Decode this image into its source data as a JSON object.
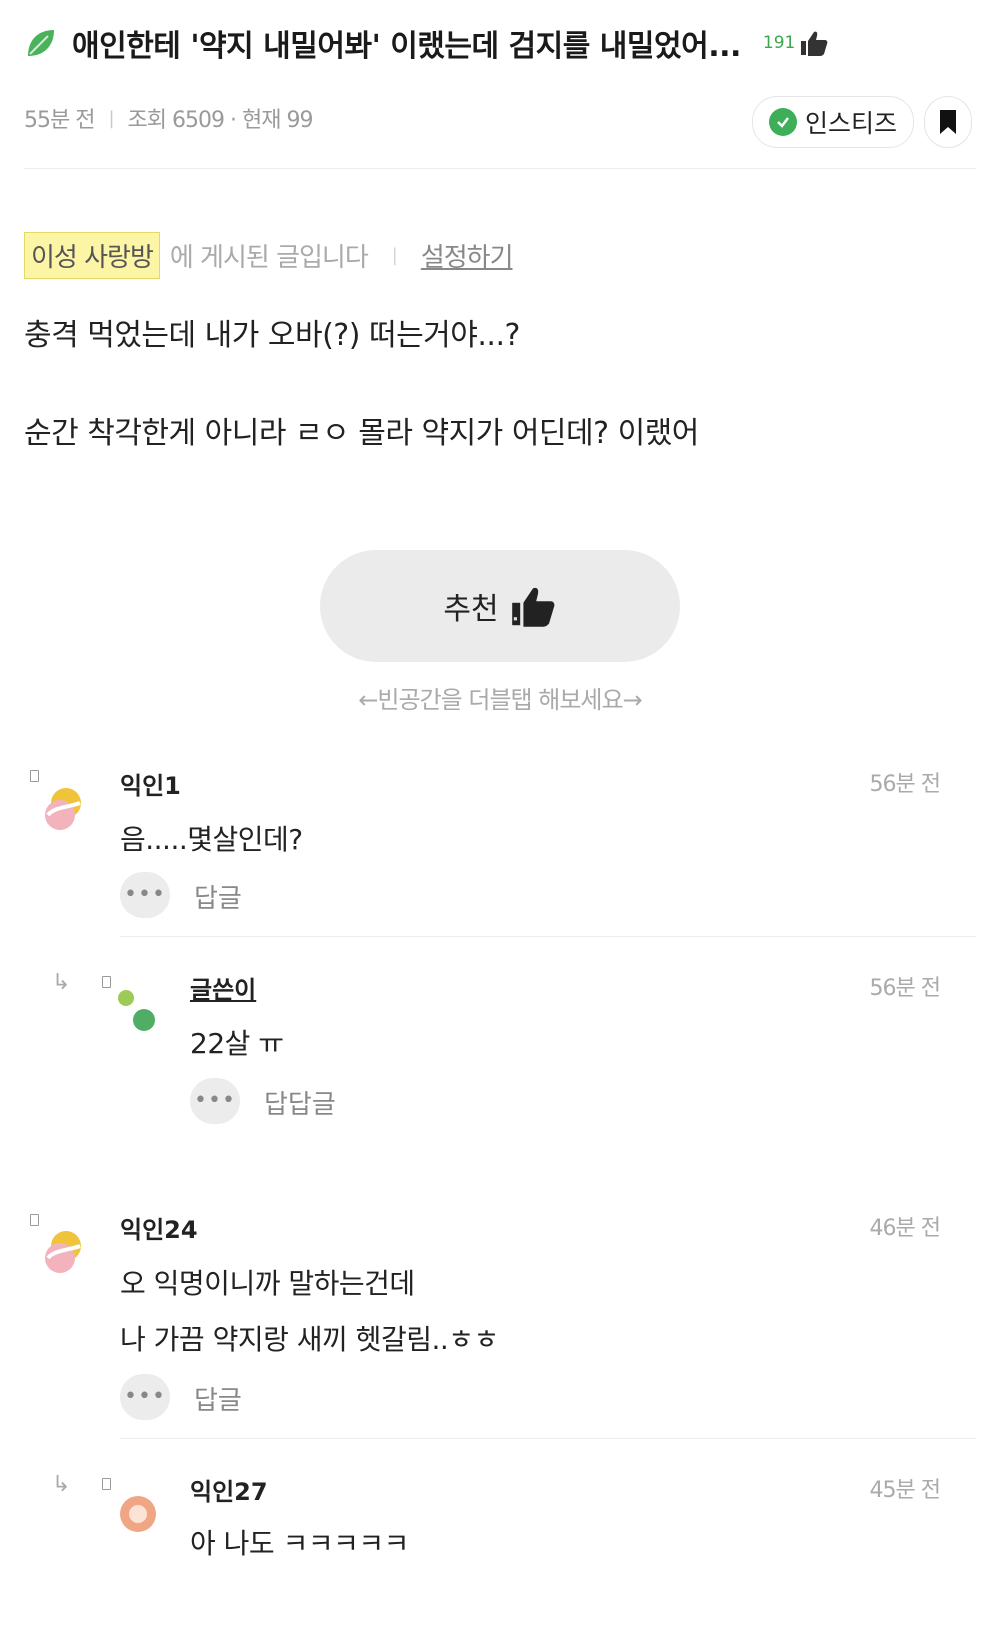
{
  "post": {
    "title": "애인한테 '약지 내밀어봐' 이랬는데 검지를 내밀었어...",
    "likes": "191",
    "posted_ago": "55분 전",
    "views": "조회 6509 · 현재 99",
    "board_chip": "인스티즈",
    "board_name": "이성 사랑방",
    "board_suffix": "에 게시된 글입니다",
    "settings": "설정하기",
    "body": [
      "충격 먹었는데 내가 오바(?) 떠는거야...?",
      "순간 착각한게 아니라 ㄹㅇ 몰라 약지가 어딘데? 이랬어"
    ],
    "recommend_label": "추천",
    "double_tap_hint": "←빈공간을 더블탭 해보세요→"
  },
  "comments": [
    {
      "name": "익인1",
      "time": "56분 전",
      "lines": [
        "음.....몇살인데?"
      ],
      "action": "답글"
    },
    {
      "name": "글쓴이",
      "time": "56분 전",
      "lines": [
        "22살 ㅠ"
      ],
      "action": "답답글"
    },
    {
      "name": "익인24",
      "time": "46분 전",
      "lines": [
        "오 익명이니까 말하는건데",
        "나 가끔 약지랑 새끼 헷갈림..ㅎㅎ"
      ],
      "action": "답글"
    },
    {
      "name": "익인27",
      "time": "45분 전",
      "lines": [
        "아 나도 ㅋㅋㅋㅋㅋ"
      ]
    }
  ],
  "colors": {
    "accent_green": "#3fae58",
    "board_tag_bg": "#fdf5a6",
    "button_gray": "#ebebeb"
  },
  "icons": [
    "leaf-icon",
    "thumbs-up-icon",
    "bookmark-icon",
    "check-icon",
    "reply-arrow-icon",
    "more-icon"
  ]
}
